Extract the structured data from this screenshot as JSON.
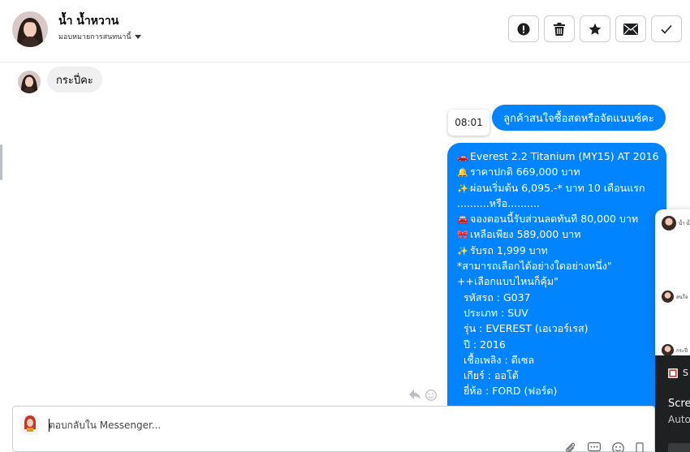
{
  "header": {
    "contact_name": "น้ำ น้ำหวาน",
    "assign_label": "มอบหมายการสนทนานี้",
    "actions": [
      {
        "name": "alert-button",
        "icon": "exclamation-circle-icon"
      },
      {
        "name": "delete-button",
        "icon": "trash-icon"
      },
      {
        "name": "star-button",
        "icon": "star-icon"
      },
      {
        "name": "mark-unread-button",
        "icon": "envelope-icon"
      },
      {
        "name": "done-button",
        "icon": "check-icon"
      }
    ]
  },
  "messages": {
    "incoming_1": "กระปี่คะ",
    "time_chip": "08:01",
    "outgoing_1": "ลูกค้าสนใจซื้อสดหรือจัดแนนซ์คะ",
    "outgoing_2_lines": [
      {
        "emoji": "🚗",
        "text": "Everest 2.2 Titanium (MY15) AT 2016"
      },
      {
        "emoji": "🔔",
        "text": "ราคาปกติ 669,000 บาท"
      },
      {
        "emoji": "✨",
        "text": "ผ่อนเริ่มต้น 6,095.-* บาท 10 เดือนแรก"
      },
      {
        "emoji": "",
        "text": "..........หรือ.........."
      },
      {
        "emoji": "🚘",
        "text": "จองตอนนี้รับส่วนลดทันที 80,000 บาท"
      },
      {
        "emoji": "🎀",
        "text": "เหลือเพียง 589,000 บาท"
      },
      {
        "emoji": "✨",
        "text": "รับรถ 1,999 บาท"
      },
      {
        "emoji": "",
        "text": "*สามารถเลือกได้อย่างใดอย่างหนึ่ง\""
      },
      {
        "emoji": "",
        "text": "++เลือกแบบไหนก็คุ้ม\""
      },
      {
        "emoji": "",
        "text": "  รหัสรถ : G037"
      },
      {
        "emoji": "",
        "text": "  ประเภท : SUV"
      },
      {
        "emoji": "",
        "text": "  รุ่น : EVEREST (เอเวอร์เรส)"
      },
      {
        "emoji": "",
        "text": "  ปี : 2016"
      },
      {
        "emoji": "",
        "text": "  เชื้อเพลิง : ดีเซล"
      },
      {
        "emoji": "",
        "text": "  เกียร์ : ออโต้"
      },
      {
        "emoji": "",
        "text": "  ยี่ห้อ : FORD (ฟอร์ด)"
      }
    ]
  },
  "side_panel": {
    "rows": [
      "น้ำ น้ำ",
      "สนใจ",
      "กระปี่"
    ]
  },
  "toast": {
    "title_fragment": "S",
    "line1": "Scre",
    "line2": "Auto"
  },
  "composer": {
    "placeholder": "ตอบกลับใน Messenger..."
  },
  "colors": {
    "brand_blue": "#0084ff",
    "incoming_bubble": "#f0f0f0",
    "toast_bg": "#1f2021"
  }
}
